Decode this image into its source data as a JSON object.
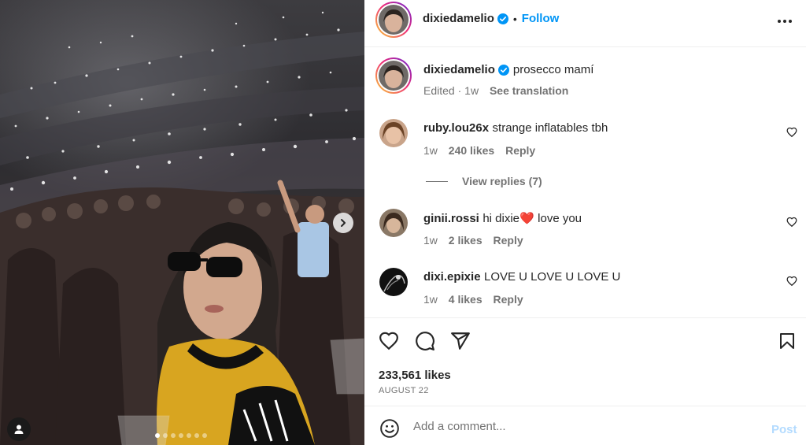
{
  "post": {
    "author": {
      "username": "dixiedamelio",
      "verified": true,
      "follow_label": "Follow",
      "separator": "•"
    },
    "caption": {
      "username": "dixiedamelio",
      "text": "prosecco mamí",
      "edited_label": "Edited",
      "meta_separator": "·",
      "time": "1w",
      "translate_label": "See translation"
    },
    "media": {
      "carousel_total": 7,
      "carousel_active": 1
    },
    "comments": [
      {
        "username": "ruby.lou26x",
        "text": "strange inflatables tbh",
        "time": "1w",
        "likes": "240 likes",
        "reply_label": "Reply",
        "view_replies": "View replies (7)"
      },
      {
        "username": "ginii.rossi",
        "text_before": "hi dixie",
        "emoji": "❤️",
        "text_after": "love you",
        "time": "1w",
        "likes": "2 likes",
        "reply_label": "Reply"
      },
      {
        "username": "dixi.epixie",
        "text": "LOVE U LOVE U LOVE U",
        "time": "1w",
        "likes": "4 likes",
        "reply_label": "Reply"
      }
    ],
    "likes_count": "233,561 likes",
    "date": "AUGUST 22",
    "add_comment": {
      "placeholder": "Add a comment...",
      "post_label": "Post"
    }
  },
  "colors": {
    "accent": "#0095f6",
    "post_disabled": "#b3dbff",
    "text_primary": "#262626",
    "text_secondary": "#737373",
    "heart_red": "#ff3040"
  },
  "icons": {
    "more": "more-horizontal-icon",
    "like": "heart-icon",
    "comment": "comment-bubble-icon",
    "share": "paper-plane-icon",
    "save": "bookmark-icon",
    "emoji": "smiley-icon",
    "next": "chevron-right-icon",
    "tag": "user-tag-icon",
    "verified": "verified-badge-icon"
  }
}
